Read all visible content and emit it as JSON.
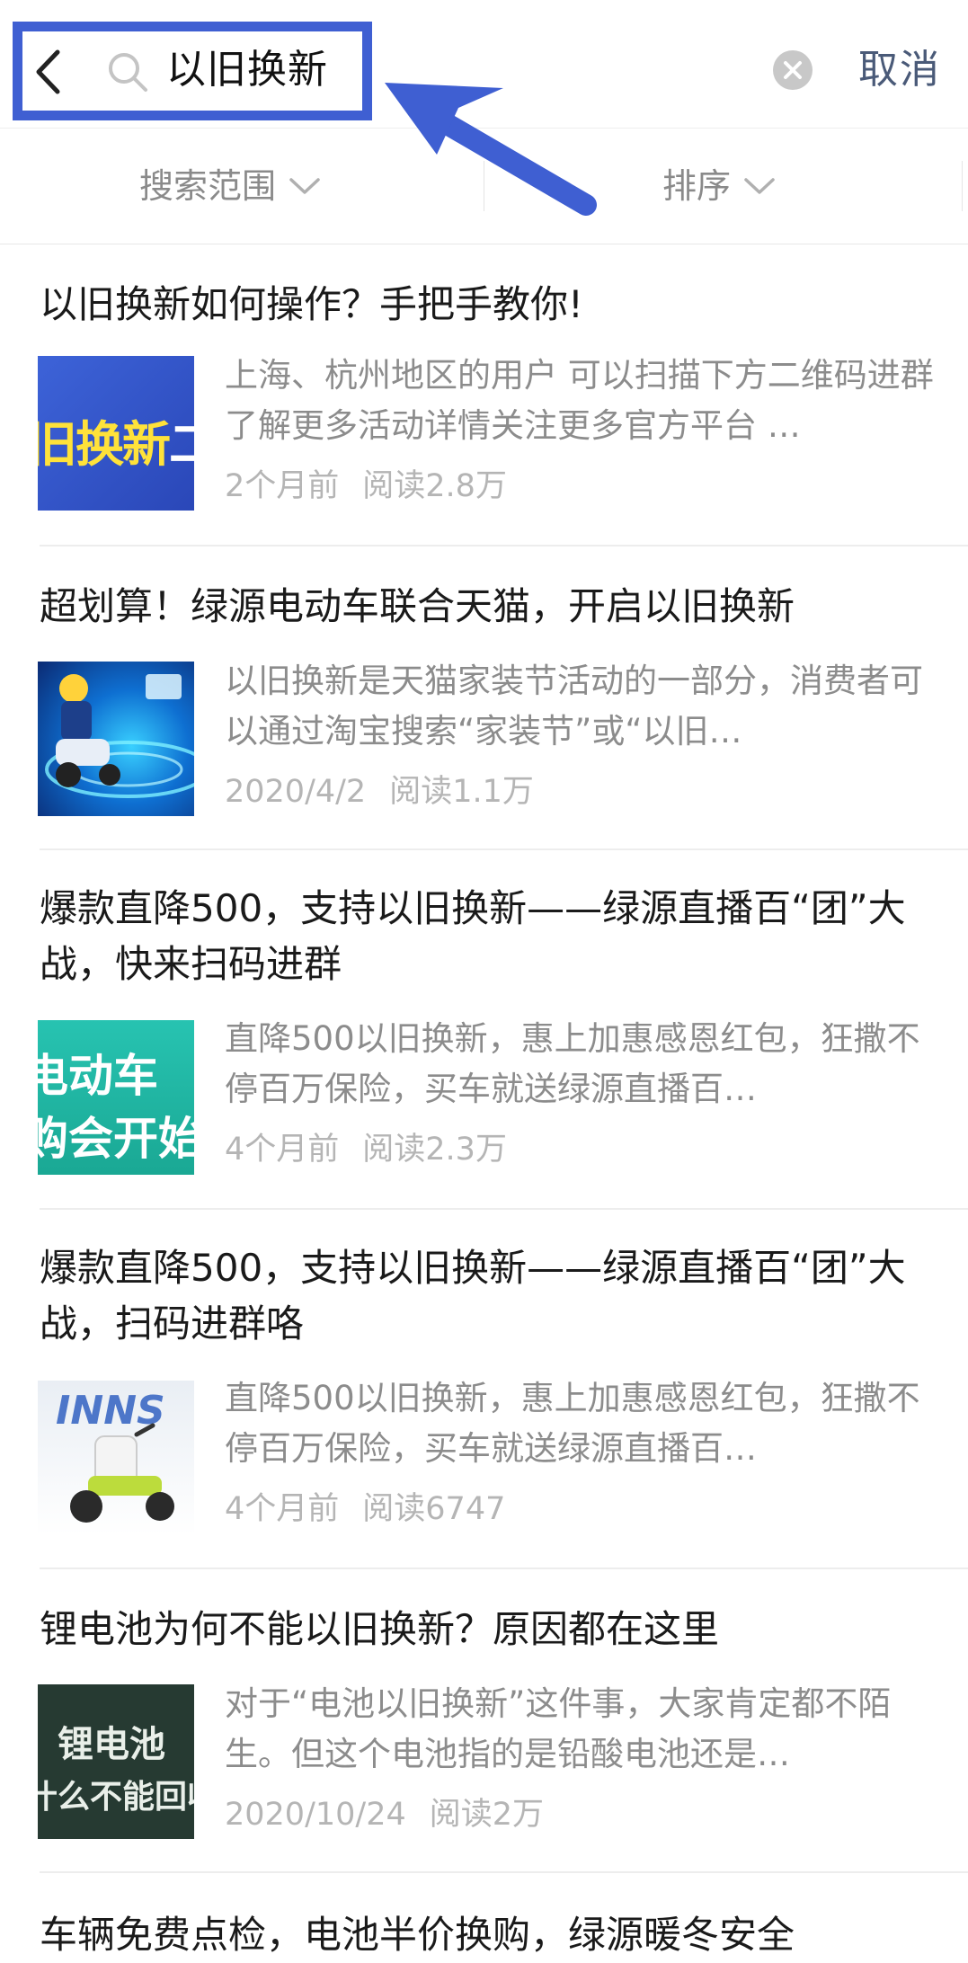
{
  "header": {
    "query": "以旧换新",
    "cancel_label": "取消"
  },
  "filters": [
    {
      "label": "搜索范围"
    },
    {
      "label": "排序"
    }
  ],
  "results": [
    {
      "title": "以旧换新如何操作？手把手教你!",
      "snippet": "上海、杭州地区的用户 可以扫描下方二维码进群了解更多活动详情关注更多官方平台 …",
      "time": "2个月前",
      "reads": "阅读2.8万",
      "thumb_text_a": "旧换新",
      "thumb_text_b": "二三"
    },
    {
      "title": "超划算！绿源电动车联合天猫，开启以旧换新",
      "snippet": "以旧换新是天猫家装节活动的一部分，消费者可以通过淘宝搜索“家装节”或“以旧…",
      "time": "2020/4/2",
      "reads": "阅读1.1万"
    },
    {
      "title": "爆款直降500，支持以旧换新——绿源直播百“团”大战，快来扫码进群",
      "snippet": "直降500以旧换新，惠上加惠感恩红包，狂撒不停百万保险，买车就送绿源直播百…",
      "time": "4个月前",
      "reads": "阅读2.3万",
      "thumb_text_a": "电动车",
      "thumb_text_b": "购会开始"
    },
    {
      "title": "爆款直降500，支持以旧换新——绿源直播百“团”大战，扫码进群咯",
      "snippet": "直降500以旧换新，惠上加惠感恩红包，狂撒不停百万保险，买车就送绿源直播百…",
      "time": "4个月前",
      "reads": "阅读6747",
      "thumb_text_a": "INNS"
    },
    {
      "title": "锂电池为何不能以旧换新？原因都在这里",
      "snippet": "对于“电池以旧换新”这件事，大家肯定都不陌生。但这个电池指的是铅酸电池还是…",
      "time": "2020/10/24",
      "reads": "阅读2万",
      "thumb_text_a": "锂电池",
      "thumb_text_b": "什么不能回收"
    },
    {
      "title": "车辆免费点检，电池半价换购，绿源暖冬安全"
    }
  ],
  "colors": {
    "highlight": "#3f5fd2",
    "muted": "#8c8c8c",
    "meta": "#b5b5b5"
  }
}
